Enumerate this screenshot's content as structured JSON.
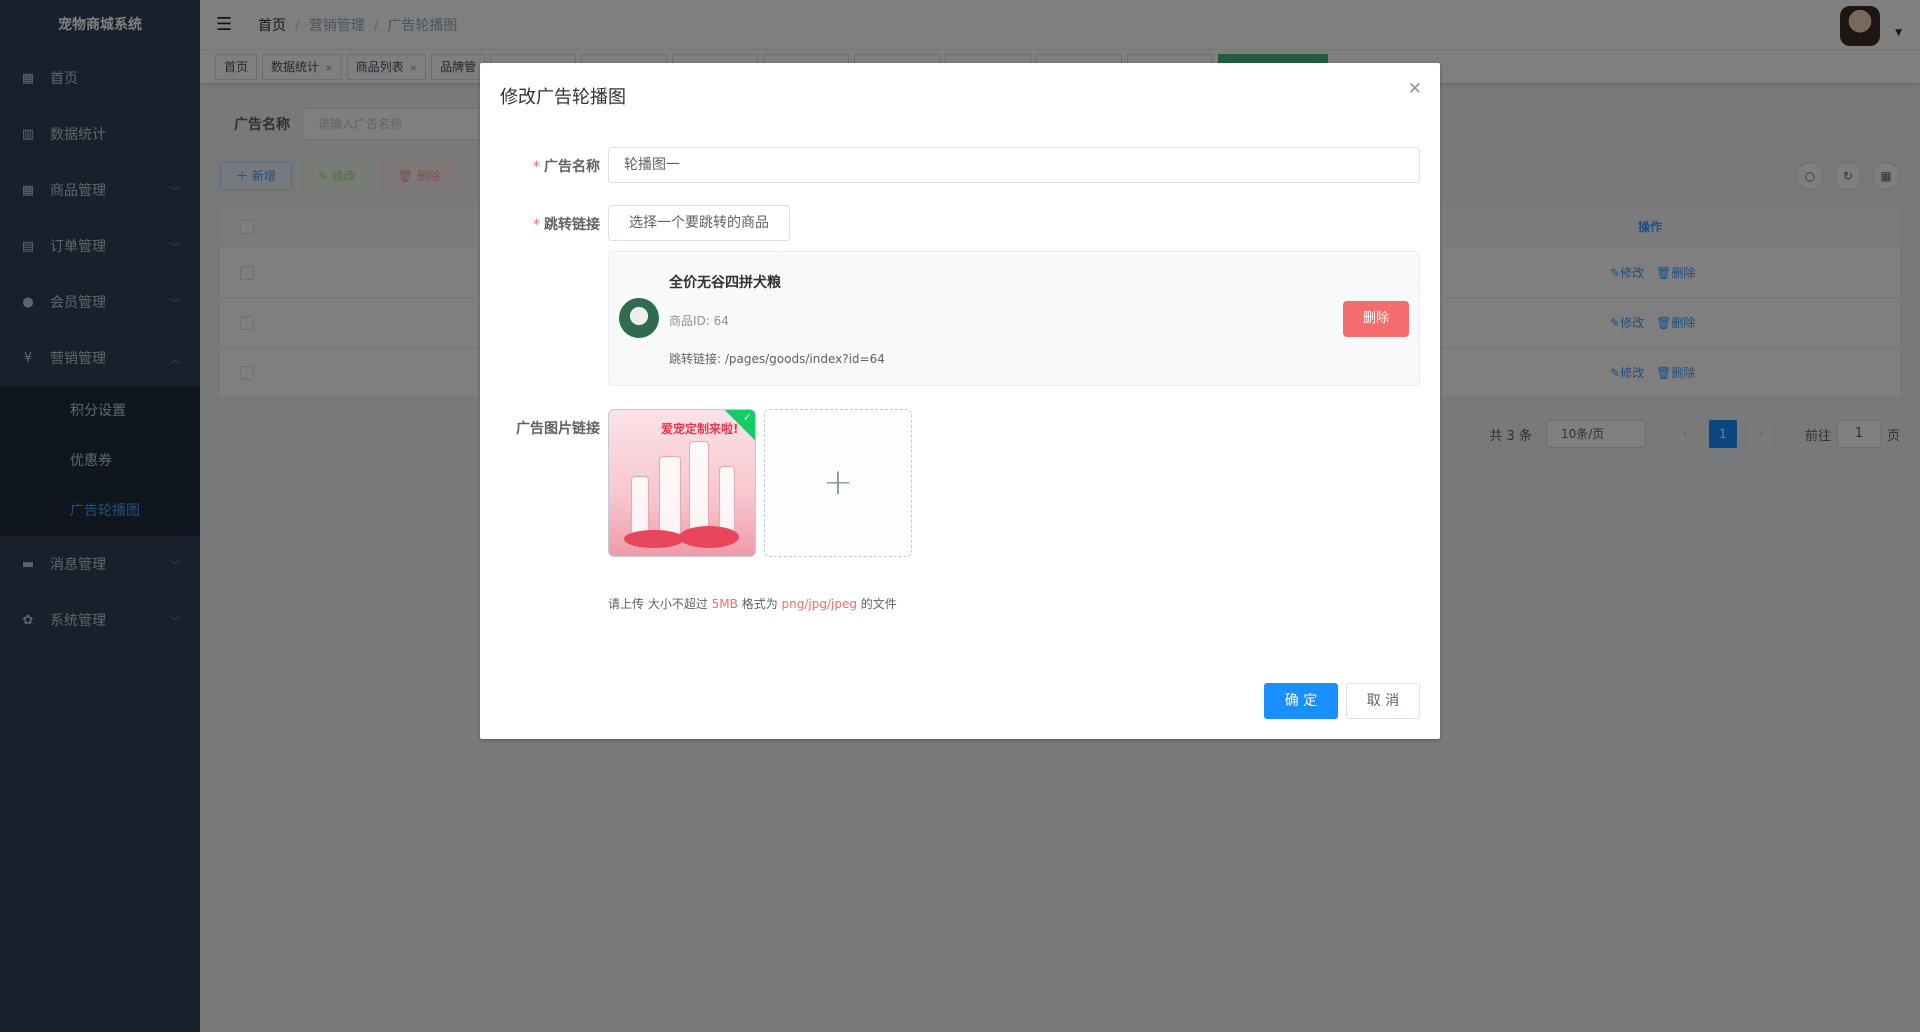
{
  "sidebar": {
    "title": "宠物商城系统",
    "items": [
      {
        "label": "首页",
        "icon": "dashboard-icon",
        "glyph": "▦"
      },
      {
        "label": "数据统计",
        "icon": "chart-icon",
        "glyph": "▥"
      },
      {
        "label": "商品管理",
        "icon": "grid-icon",
        "glyph": "▦"
      },
      {
        "label": "订单管理",
        "icon": "order-icon",
        "glyph": "▤"
      },
      {
        "label": "会员管理",
        "icon": "user-icon",
        "glyph": "●"
      },
      {
        "label": "营销管理",
        "icon": "yen-icon",
        "glyph": "¥"
      },
      {
        "label": "消息管理",
        "icon": "message-icon",
        "glyph": "▬"
      },
      {
        "label": "系统管理",
        "icon": "gear-icon",
        "glyph": "✿"
      }
    ],
    "submenu": [
      "积分设置",
      "优惠券",
      "广告轮播图"
    ]
  },
  "breadcrumb": [
    "首页",
    "营销管理",
    "广告轮播图"
  ],
  "tags": [
    "首页",
    "数据统计",
    "商品列表",
    "品牌管"
  ],
  "search": {
    "label": "广告名称",
    "placeholder": "请输入广告名称"
  },
  "buttons": {
    "add": "新增",
    "edit": "修改",
    "delete": "删除"
  },
  "table": {
    "op_header": "操作",
    "row_edit": "修改",
    "row_delete": "删除",
    "rows": 3
  },
  "pagination": {
    "total": "共 3 条",
    "page_size": "10条/页",
    "current": "1",
    "goto": "前往",
    "goto_value": "1",
    "page_unit": "页"
  },
  "dialog": {
    "title": "修改广告轮播图",
    "name_label": "广告名称",
    "name_value": "轮播图一",
    "link_label": "跳转链接",
    "select_goods_button": "选择一个要跳转的商品",
    "goods": {
      "name": "全价无谷四拼犬粮",
      "id_text": "商品ID: 64",
      "link_text": "跳转链接: /pages/goods/index?id=64",
      "delete_label": "删除"
    },
    "image_label": "广告图片链接",
    "image_banner_text": "爱宠定制来啦!",
    "tip": {
      "prefix": "请上传 大小不超过 ",
      "size": "5MB",
      "middle": " 格式为 ",
      "formats": "png/jpg/jpeg",
      "suffix": " 的文件"
    },
    "ok_label": "确 定",
    "cancel_label": "取 消"
  },
  "colors": {
    "primary": "#1890ff",
    "danger": "#f56c6c",
    "sidebar_bg": "#304156",
    "success": "#13ce66"
  }
}
